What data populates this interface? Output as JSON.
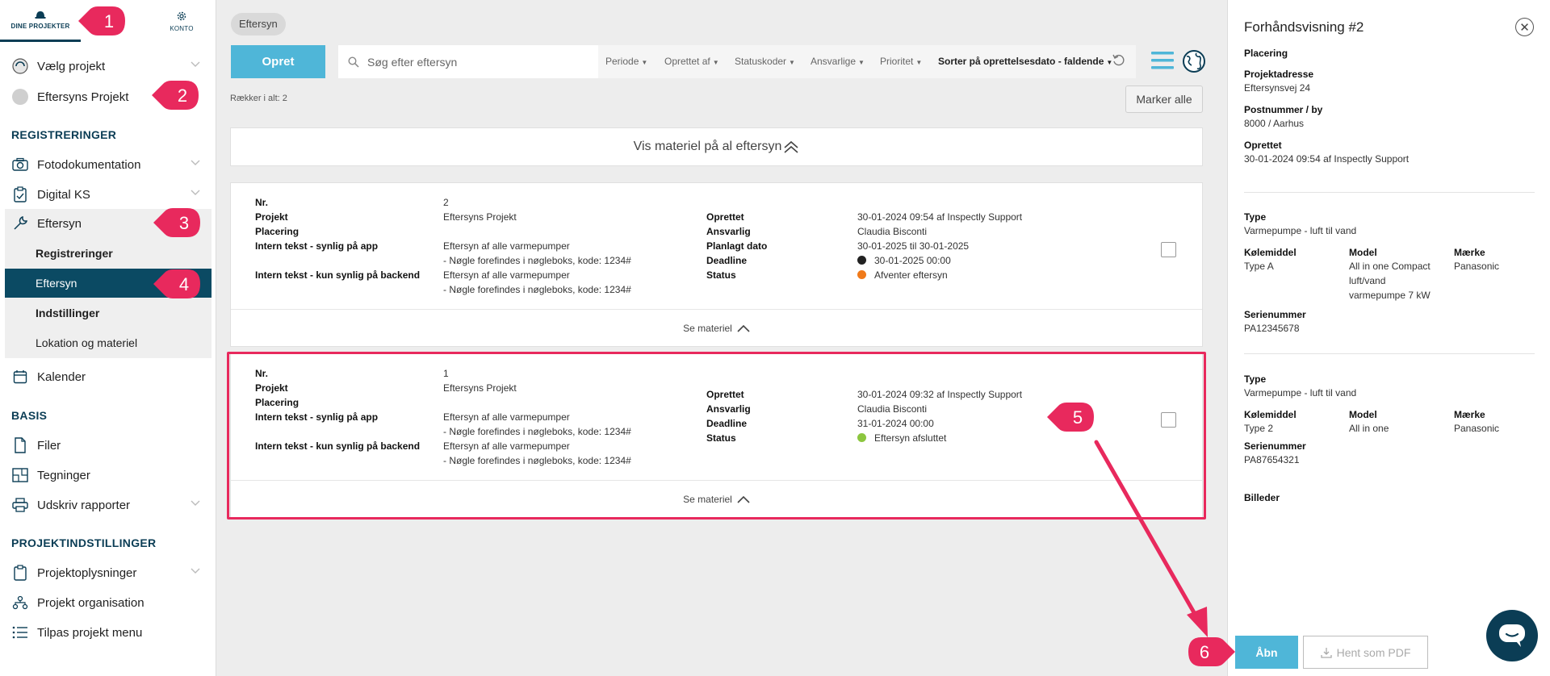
{
  "sidebar": {
    "tabs": {
      "projects": "DINE PROJEKTER",
      "account": "KONTO"
    },
    "select_project": "Vælg projekt",
    "current_project": "Eftersyns Projekt",
    "section_registrations": "REGISTRERINGER",
    "photo_doc": "Fotodokumentation",
    "digital_ks": "Digital KS",
    "inspection": "Eftersyn",
    "sub": {
      "registrations": "Registreringer",
      "inspection": "Eftersyn",
      "settings": "Indstillinger",
      "location": "Lokation og materiel"
    },
    "calendar": "Kalender",
    "section_basis": "BASIS",
    "files": "Filer",
    "drawings": "Tegninger",
    "print_reports": "Udskriv rapporter",
    "section_project_settings": "PROJEKTINDSTILLINGER",
    "project_info": "Projektoplysninger",
    "project_org": "Projekt organisation",
    "customize_menu": "Tilpas projekt menu"
  },
  "main": {
    "breadcrumb": "Eftersyn",
    "create_button": "Opret",
    "search_placeholder": "Søg efter eftersyn",
    "filters": {
      "period": "Periode",
      "created_by": "Oprettet af",
      "status_codes": "Statuskoder",
      "responsible": "Ansvarlige",
      "priority": "Prioritet",
      "sort": "Sorter på oprettelsesdato - faldende"
    },
    "row_count": "Rækker i alt: 2",
    "mark_all": "Marker alle",
    "show_material_all": "Vis materiel på al eftersyn",
    "labels": {
      "nr": "Nr.",
      "project": "Projekt",
      "placement": "Placering",
      "internal_app": "Intern tekst - synlig på app",
      "internal_backend": "Intern tekst - kun synlig på backend",
      "created": "Oprettet",
      "responsible": "Ansvarlig",
      "planned_date": "Planlagt dato",
      "deadline": "Deadline",
      "status": "Status"
    },
    "see_material": "Se materiel",
    "cards": [
      {
        "nr": "2",
        "project": "Eftersyns Projekt",
        "internal_app_1": "Eftersyn af alle varmepumper",
        "internal_app_2": "- Nøgle forefindes i nøgleboks, kode: 1234#",
        "internal_backend_1": "Eftersyn af alle varmepumper",
        "internal_backend_2": "- Nøgle forefindes i nøgleboks, kode: 1234#",
        "created": "30-01-2024 09:54 af Inspectly Support",
        "responsible": "Claudia Bisconti",
        "planned_date": "30-01-2025 til 30-01-2025",
        "deadline": "30-01-2025 00:00",
        "status": "Afventer eftersyn",
        "deadline_color": "#222222",
        "status_color": "#f07a1a"
      },
      {
        "nr": "1",
        "project": "Eftersyns Projekt",
        "internal_app_1": "Eftersyn af alle varmepumper",
        "internal_app_2": "- Nøgle forefindes i nøgleboks, kode: 1234#",
        "internal_backend_1": "Eftersyn af alle varmepumper",
        "internal_backend_2": "- Nøgle forefindes i nøgleboks, kode: 1234#",
        "created": "30-01-2024 09:32 af Inspectly Support",
        "responsible": "Claudia Bisconti",
        "deadline": "31-01-2024 00:00",
        "status": "Eftersyn afsluttet",
        "status_color": "#8cc63f"
      }
    ]
  },
  "preview": {
    "title": "Forhåndsvisning #2",
    "placement_label": "Placering",
    "address_label": "Projektadresse",
    "address": "Eftersynsvej 24",
    "postal_label": "Postnummer / by",
    "postal": "8000 / Aarhus",
    "created_label": "Oprettet",
    "created": "30-01-2024 09:54 af Inspectly Support",
    "items": [
      {
        "type_label": "Type",
        "type": "Varmepumpe - luft til vand",
        "coolant_label": "Kølemiddel",
        "coolant": "Type A",
        "model_label": "Model",
        "model": "All in one Compact luft/vand varmepumpe 7 kW",
        "brand_label": "Mærke",
        "brand": "Panasonic",
        "serial_label": "Serienummer",
        "serial": "PA12345678"
      },
      {
        "type_label": "Type",
        "type": "Varmepumpe - luft til vand",
        "coolant_label": "Kølemiddel",
        "coolant": "Type 2",
        "model_label": "Model",
        "model": "All in one",
        "brand_label": "Mærke",
        "brand": "Panasonic",
        "serial_label": "Serienummer",
        "serial": "PA87654321"
      }
    ],
    "images_label": "Billeder",
    "open_button": "Åbn",
    "pdf_button": "Hent som PDF"
  },
  "callouts": [
    "1",
    "2",
    "3",
    "4",
    "5",
    "6"
  ],
  "colors": {
    "brand": "#0b3d55",
    "accent": "#4fb6d8",
    "callout": "#e8295d"
  }
}
